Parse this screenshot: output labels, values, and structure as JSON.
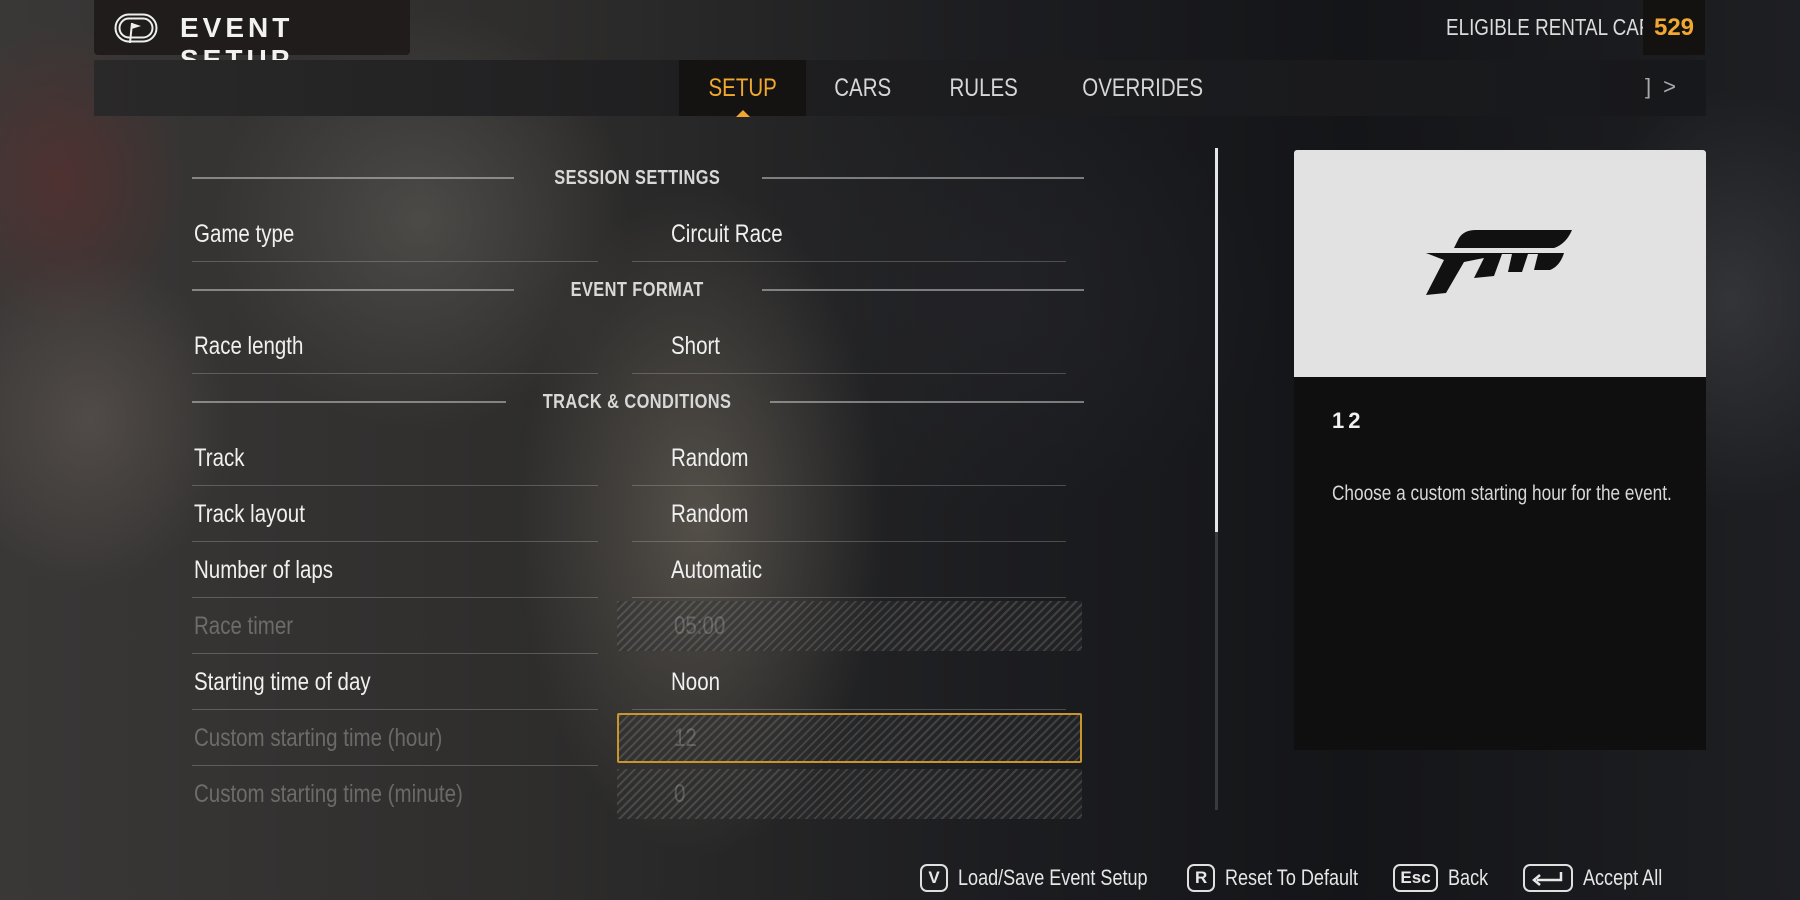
{
  "header": {
    "title": "EVENT SETUP",
    "eligible_label": "ELIGIBLE RENTAL CARS",
    "eligible_count": "529",
    "accent_color": "#f0a830"
  },
  "tabs": [
    {
      "label": "SETUP",
      "active": true
    },
    {
      "label": "CARS",
      "active": false
    },
    {
      "label": "RULES",
      "active": false
    },
    {
      "label": "OVERRIDES",
      "active": false
    }
  ],
  "tab_nav": {
    "bumper": "]",
    "arrow": ">"
  },
  "sections": {
    "session_settings": "SESSION SETTINGS",
    "event_format": "EVENT FORMAT",
    "track_conditions": "TRACK & CONDITIONS"
  },
  "settings": {
    "game_type": {
      "label": "Game type",
      "value": "Circuit Race"
    },
    "race_length": {
      "label": "Race length",
      "value": "Short"
    },
    "track": {
      "label": "Track",
      "value": "Random"
    },
    "track_layout": {
      "label": "Track layout",
      "value": "Random"
    },
    "number_of_laps": {
      "label": "Number of laps",
      "value": "Automatic"
    },
    "race_timer": {
      "label": "Race timer",
      "value": "05:00",
      "disabled": true
    },
    "starting_time_of_day": {
      "label": "Starting time of day",
      "value": "Noon"
    },
    "custom_hour": {
      "label": "Custom starting time (hour)",
      "value": "12",
      "disabled": true,
      "focused": true
    },
    "custom_minute": {
      "label": "Custom starting time (minute)",
      "value": "0",
      "disabled": true
    }
  },
  "scroll": {
    "position_fraction": 0.0,
    "visible_fraction": 0.58
  },
  "preview": {
    "logo": "forza-logo",
    "value": "12",
    "description": "Choose a custom starting hour for the event."
  },
  "footer": [
    {
      "key": "V",
      "label": "Load/Save Event Setup"
    },
    {
      "key": "R",
      "label": "Reset To Default"
    },
    {
      "key": "Esc",
      "label": "Back"
    },
    {
      "key": "enter-icon",
      "label": "Accept All"
    }
  ]
}
